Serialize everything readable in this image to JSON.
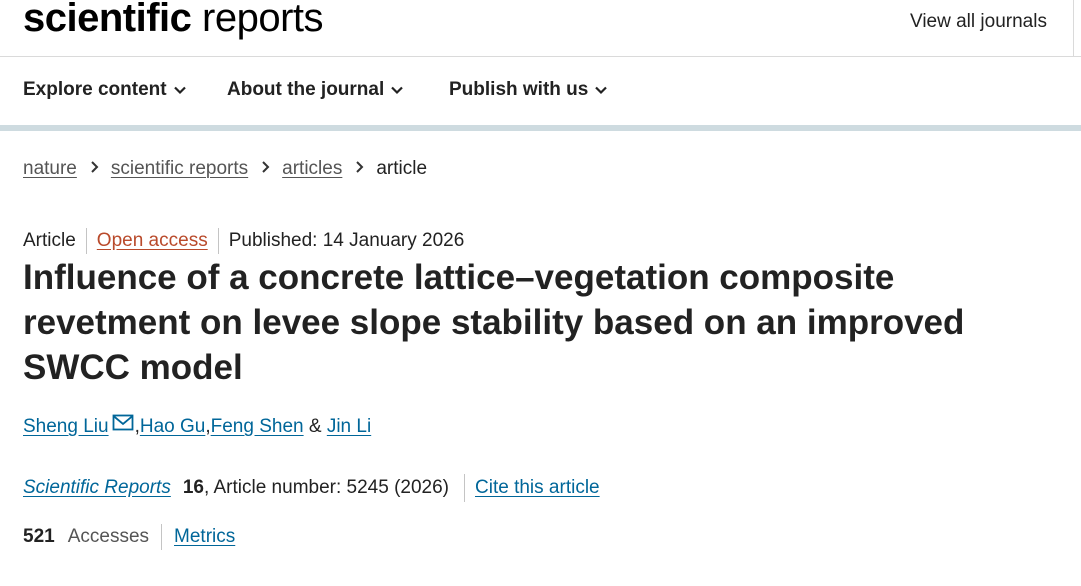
{
  "header": {
    "logo_bold": "scientific",
    "logo_light": "reports",
    "view_all_label": "View all journals"
  },
  "nav": {
    "items": [
      {
        "label": "Explore content"
      },
      {
        "label": "About the journal"
      },
      {
        "label": "Publish with us"
      }
    ]
  },
  "breadcrumb": {
    "items": [
      "nature",
      "scientific reports",
      "articles"
    ],
    "current": "article",
    "separator": "›"
  },
  "article": {
    "type": "Article",
    "access": "Open access",
    "published": "Published: 14 January 2026",
    "title": "Influence of a concrete lattice–vegetation composite revetment on levee slope stability based on an improved SWCC model",
    "authors": [
      {
        "name": "Sheng Liu",
        "corresponding": true
      },
      {
        "name": "Hao Gu"
      },
      {
        "name": "Feng Shen"
      },
      {
        "name": "Jin Li"
      }
    ],
    "author_sep_1": ", ",
    "author_sep_2": ", ",
    "author_sep_3": " & ",
    "journal": "Scientific Reports",
    "volume": "16",
    "article_number": ", Article number: 5245 (2026)",
    "cite_label": "Cite this article",
    "accesses_count": "521",
    "accesses_label": "Accesses",
    "metrics_label": "Metrics"
  },
  "colors": {
    "link": "#006699",
    "open_access": "#b94a2b",
    "nav_bar": "#cedbe0"
  },
  "icons": {
    "nav_chevron": "chevron-down-icon",
    "breadcrumb_sep": "chevron-right-icon",
    "corresponding": "envelope-icon"
  }
}
